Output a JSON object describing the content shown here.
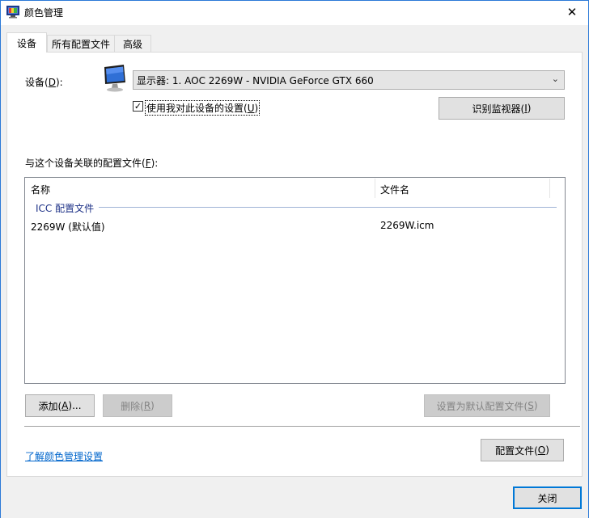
{
  "window": {
    "title": "颜色管理",
    "close_glyph": "✕"
  },
  "tabs": [
    {
      "label": "设备",
      "selected": true
    },
    {
      "label": "所有配置文件",
      "selected": false
    },
    {
      "label": "高级",
      "selected": false
    }
  ],
  "device": {
    "label_prefix": "设备(",
    "label_key": "D",
    "label_suffix": "):",
    "selected_value": "显示器: 1. AOC 2269W - NVIDIA GeForce GTX 660",
    "dropdown_arrow": "⌄"
  },
  "use_settings": {
    "checked": true,
    "check_glyph": "✓",
    "label_prefix": "使用我对此设备的设置(",
    "label_key": "U",
    "label_suffix": ")"
  },
  "identify_button": {
    "label_prefix": "识别监视器(",
    "label_key": "I",
    "label_suffix": ")"
  },
  "associated": {
    "label_prefix": "与这个设备关联的配置文件(",
    "label_key": "F",
    "label_suffix": "):",
    "columns": [
      "名称",
      "文件名"
    ],
    "group": "ICC 配置文件",
    "rows": [
      {
        "name": "2269W (默认值)",
        "file": "2269W.icm"
      }
    ]
  },
  "buttons": {
    "add": {
      "prefix": "添加(",
      "key": "A",
      "suffix": ")..."
    },
    "remove": {
      "prefix": "删除(",
      "key": "R",
      "suffix": ")"
    },
    "set_default": {
      "prefix": "设置为默认配置文件(",
      "key": "S",
      "suffix": ")"
    },
    "profiles": {
      "prefix": "配置文件(",
      "key": "O",
      "suffix": ")"
    },
    "close": "关闭"
  },
  "learn_link": "了解颜色管理设置",
  "colors": {
    "accent": "#0078d7",
    "link": "#0066cc",
    "group_header": "#1e3287"
  }
}
